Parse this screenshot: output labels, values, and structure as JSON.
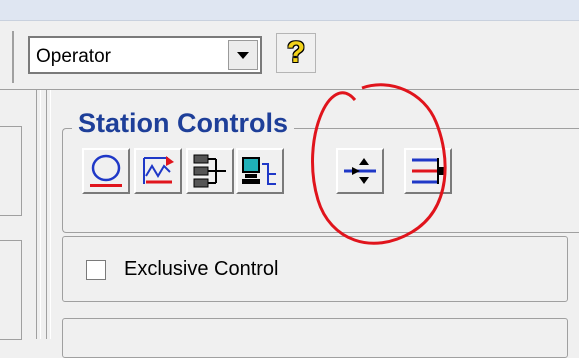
{
  "toolbar": {
    "role_select": {
      "value": "Operator"
    },
    "help_glyph": "?"
  },
  "station_controls": {
    "title": "Station Controls",
    "buttons": [
      {
        "icon": "station-circle-icon"
      },
      {
        "icon": "trend-graph-icon"
      },
      {
        "icon": "network-tree-icon"
      },
      {
        "icon": "workstation-network-icon"
      },
      {
        "icon": "vertical-arrows-connector-icon"
      },
      {
        "icon": "rack-connector-icon"
      }
    ],
    "exclusive_control": {
      "label": "Exclusive Control",
      "checked": false
    }
  },
  "colors": {
    "title_blue": "#1e3f99",
    "annotation_red": "#e0141c",
    "help_yellow": "#f2d21a"
  }
}
